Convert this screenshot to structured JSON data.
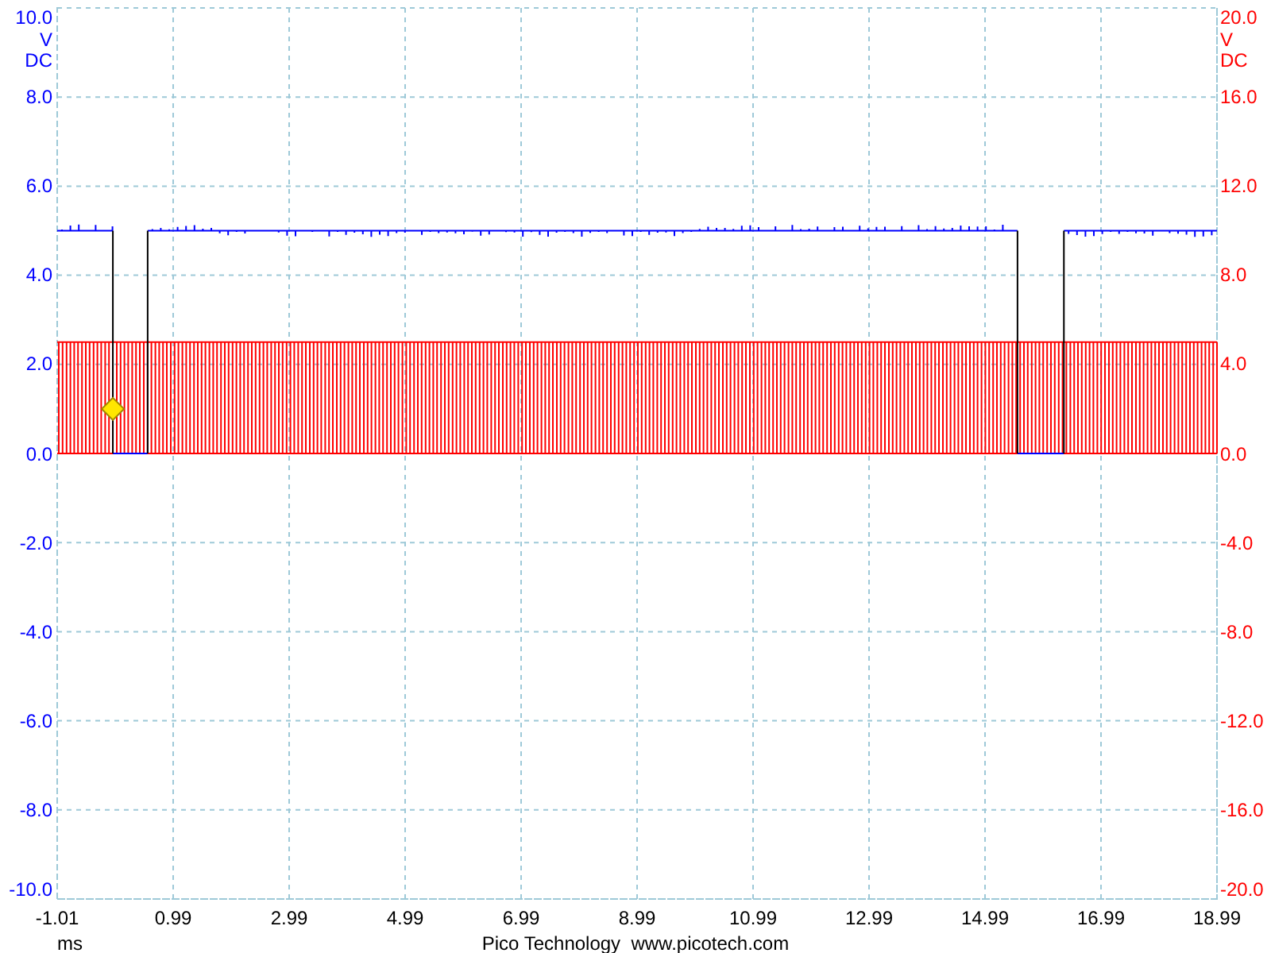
{
  "left_axis": {
    "color": "#0000ff",
    "units": [
      "V",
      "DC"
    ],
    "ticks": [
      "10.0",
      "8.0",
      "6.0",
      "4.0",
      "2.0",
      "0.0",
      "-2.0",
      "-4.0",
      "-6.0",
      "-8.0",
      "-10.0"
    ]
  },
  "right_axis": {
    "color": "#ff0000",
    "units": [
      "V",
      "DC"
    ],
    "ticks": [
      "20.0",
      "16.0",
      "12.0",
      "8.0",
      "4.0",
      "0.0",
      "-4.0",
      "-8.0",
      "-12.0",
      "-16.0",
      "-20.0"
    ]
  },
  "x_axis": {
    "unit": "ms",
    "ticks": [
      "-1.01",
      "0.99",
      "2.99",
      "4.99",
      "6.99",
      "8.99",
      "10.99",
      "12.99",
      "14.99",
      "16.99",
      "18.99"
    ]
  },
  "footer": "Pico Technology  www.picotech.com"
}
